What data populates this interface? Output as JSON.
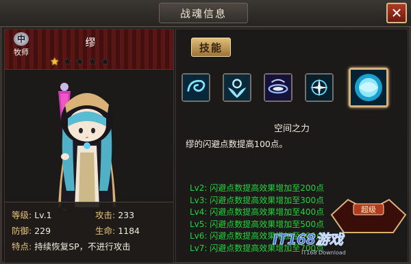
{
  "window": {
    "title": "战魂信息",
    "close_label": "✕"
  },
  "character": {
    "class_icon_text": "中",
    "class_label": "牧师",
    "name": "缪",
    "stars_filled": 1,
    "stars_total": 5,
    "stats": {
      "level_label": "等级:",
      "level_value": "Lv.1",
      "attack_label": "攻击:",
      "attack_value": "233",
      "defense_label": "防御:",
      "defense_value": "229",
      "hp_label": "生命:",
      "hp_value": "1184",
      "trait_label": "特点:",
      "trait_value": "持续恢复SP，不进行攻击"
    }
  },
  "skills": {
    "tab_label": "技能",
    "icons": [
      "swirl-skill-icon",
      "angel-wings-skill-icon",
      "vortex-skill-icon",
      "spark-skill-icon",
      "water-orb-skill-icon"
    ],
    "selected_index": 4,
    "selected_name": "空间之力",
    "description": "缪的闪避点数提高100点。",
    "levels": [
      "Lv2:  闪避点数提高效果增加至200点",
      "Lv3:  闪避点数提高效果增加至300点",
      "Lv4:  闪避点数提高效果增加至400点",
      "Lv5:  闪避点数提高效果增加至500点",
      "Lv6:  闪避点数提高效果增加至600点",
      "Lv7:  闪避点数提高效果增加至700点"
    ]
  },
  "watermark": {
    "badge": "超级",
    "site": "IT168游戏",
    "sub": "IT168 Download"
  },
  "colors": {
    "accent_gold": "#d8b277",
    "level_green": "#22d43a",
    "star_gold": "#f2c230"
  }
}
